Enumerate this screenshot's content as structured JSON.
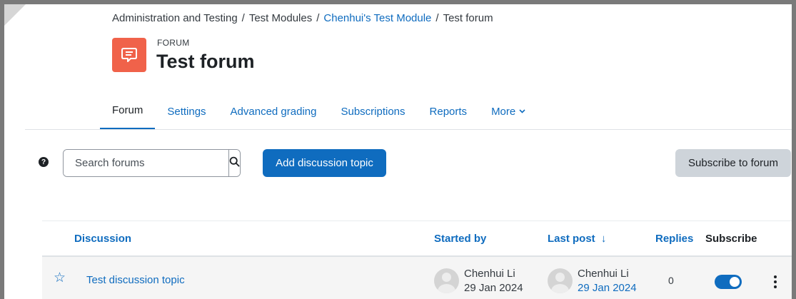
{
  "breadcrumb": {
    "items": [
      {
        "label": "Administration and Testing",
        "link": false
      },
      {
        "label": "Test Modules",
        "link": false
      },
      {
        "label": "Chenhui's Test Module",
        "link": true
      },
      {
        "label": "Test forum",
        "link": false
      }
    ],
    "separator": "/"
  },
  "header": {
    "kicker": "FORUM",
    "title": "Test forum",
    "icon": "forum-speech-bubble-icon",
    "icon_color": "#f0624a"
  },
  "tabs": [
    {
      "label": "Forum",
      "active": true
    },
    {
      "label": "Settings"
    },
    {
      "label": "Advanced grading"
    },
    {
      "label": "Subscriptions"
    },
    {
      "label": "Reports"
    },
    {
      "label": "More",
      "icon": "chevron-down-icon"
    }
  ],
  "toolbar": {
    "help_icon": "question-circle-icon",
    "search_placeholder": "Search forums",
    "search_icon": "search-icon",
    "add_topic_label": "Add discussion topic",
    "subscribe_label": "Subscribe to forum"
  },
  "table": {
    "headers": {
      "discussion": "Discussion",
      "started_by": "Started by",
      "last_post": "Last post",
      "last_post_sort_icon": "↓",
      "replies": "Replies",
      "subscribe": "Subscribe"
    },
    "rows": [
      {
        "starred": false,
        "topic": "Test discussion topic",
        "started_by_name": "Chenhui Li",
        "started_by_date": "29 Jan 2024",
        "last_post_name": "Chenhui Li",
        "last_post_date": "29 Jan 2024",
        "replies": "0",
        "subscribed": true
      }
    ]
  },
  "colors": {
    "accent": "#0f6cbf",
    "secondary_button": "#ced4da",
    "row_background": "#f5f5f5"
  }
}
